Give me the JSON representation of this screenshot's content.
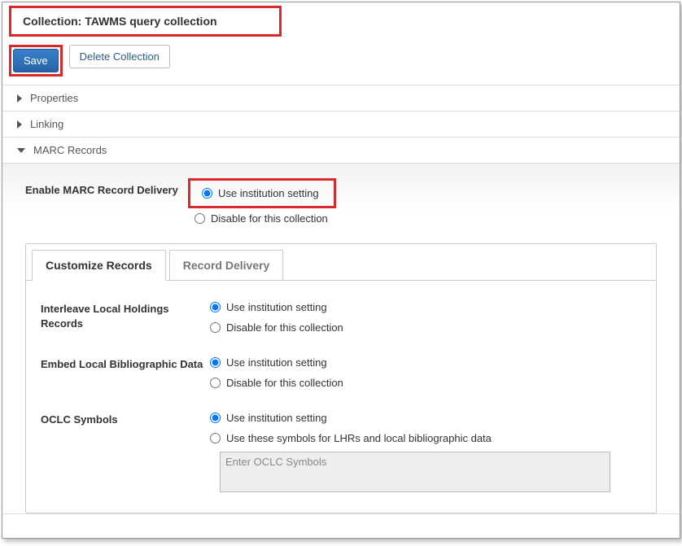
{
  "header": {
    "title_prefix": "Collection: ",
    "title_name": "TAWMS query collection"
  },
  "buttons": {
    "save_label": "Save",
    "delete_label": "Delete Collection"
  },
  "accordion": {
    "properties_label": "Properties",
    "linking_label": "Linking",
    "marc_label": "MARC Records"
  },
  "marc_delivery": {
    "label": "Enable MARC Record Delivery",
    "opt_institution": "Use institution setting",
    "opt_disable": "Disable for this collection"
  },
  "tabs": {
    "customize_label": "Customize Records",
    "delivery_label": "Record Delivery"
  },
  "customize": {
    "interleave": {
      "label": "Interleave Local Holdings Records",
      "opt_institution": "Use institution setting",
      "opt_disable": "Disable for this collection"
    },
    "embed": {
      "label": "Embed Local Bibliographic Data",
      "opt_institution": "Use institution setting",
      "opt_disable": "Disable for this collection"
    },
    "oclc": {
      "label": "OCLC Symbols",
      "opt_institution": "Use institution setting",
      "opt_custom": "Use these symbols for LHRs and local bibliographic data",
      "placeholder": "Enter OCLC Symbols"
    }
  }
}
